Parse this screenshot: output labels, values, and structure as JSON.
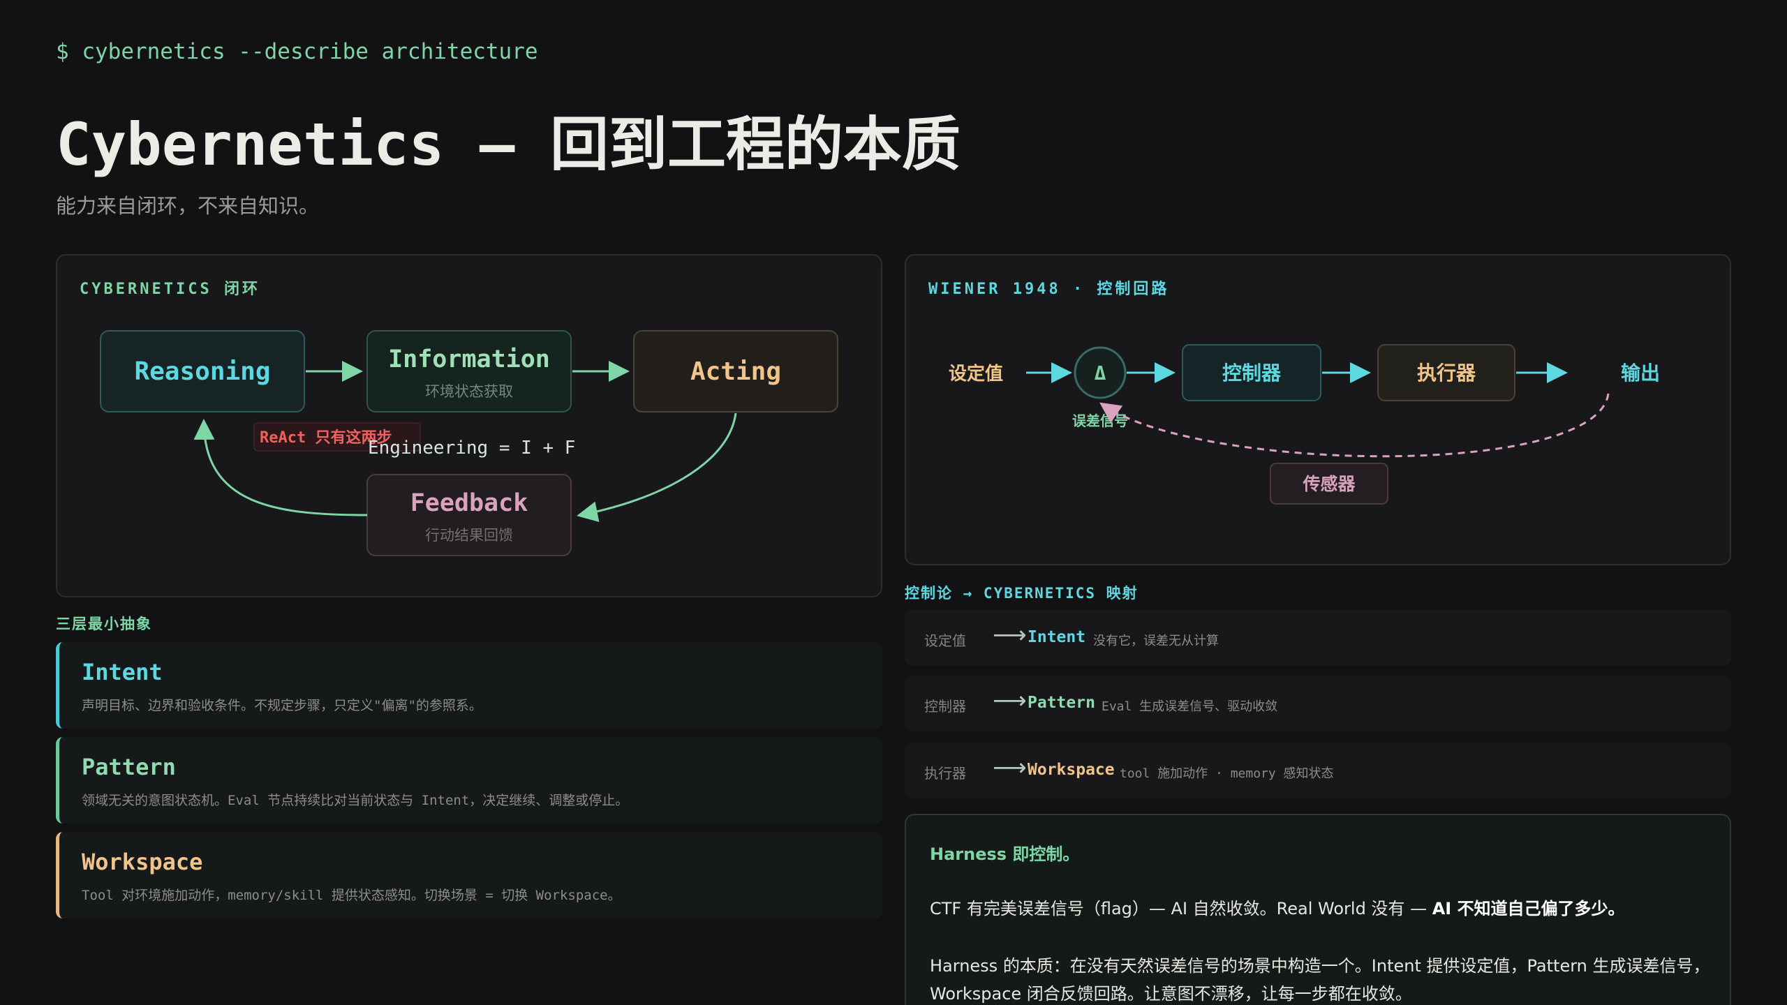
{
  "header": {
    "prompt": "$ cybernetics --describe architecture",
    "title": "Cybernetics — 回到工程的本质",
    "subtitle": "能力来自闭环，不来自知识。"
  },
  "loop_panel": {
    "label": "CYBERNETICS 闭环",
    "reasoning": "Reasoning",
    "information": "Information",
    "information_sub": "环境状态获取",
    "acting": "Acting",
    "feedback": "Feedback",
    "feedback_sub": "行动结果回馈",
    "react_note": "ReAct 只有这两步",
    "equation": "Engineering = I + F"
  },
  "wiener_panel": {
    "label": "WIENER 1948 · 控制回路",
    "setpoint": "设定值",
    "delta": "Δ",
    "error_signal": "误差信号",
    "controller": "控制器",
    "actuator": "执行器",
    "output": "输出",
    "sensor": "传感器"
  },
  "layers": {
    "label": "三层最小抽象",
    "items": [
      {
        "name": "Intent",
        "desc": "声明目标、边界和验收条件。不规定步骤，只定义\"偏离\"的参照系。"
      },
      {
        "name": "Pattern",
        "desc": "领域无关的意图状态机。Eval 节点持续比对当前状态与 Intent，决定继续、调整或停止。"
      },
      {
        "name": "Workspace",
        "desc": "Tool 对环境施加动作，memory/skill 提供状态感知。切换场景 = 切换 Workspace。"
      }
    ]
  },
  "mapping": {
    "label": "控制论 → CYBERNETICS 映射",
    "rows": [
      {
        "key": "设定值",
        "arrow": "⟶",
        "target": "Intent",
        "note": "没有它，误差无从计算"
      },
      {
        "key": "控制器",
        "arrow": "⟶",
        "target": "Pattern",
        "note": "Eval 生成误差信号、驱动收敛"
      },
      {
        "key": "执行器",
        "arrow": "⟶",
        "target": "Workspace",
        "note": "tool 施加动作 · memory 感知状态"
      }
    ]
  },
  "harness": {
    "title": "Harness 即控制。",
    "p1_a": "CTF 有完美误差信号（flag）— AI 自然收敛。Real World 没有 — ",
    "p1_b": "AI 不知道自己偏了多少。",
    "p2": "Harness 的本质：在没有天然误差信号的场景中构造一个。Intent 提供设定值，Pattern 生成误差信号，Workspace 闭合反馈回路。让意图不漂移，让每一步都在收敛。"
  },
  "colors": {
    "green": "#7ed6a6",
    "cyan": "#5ed8e0",
    "amber": "#f1c48a",
    "pink": "#d9a3c0",
    "red": "#f0605e"
  }
}
